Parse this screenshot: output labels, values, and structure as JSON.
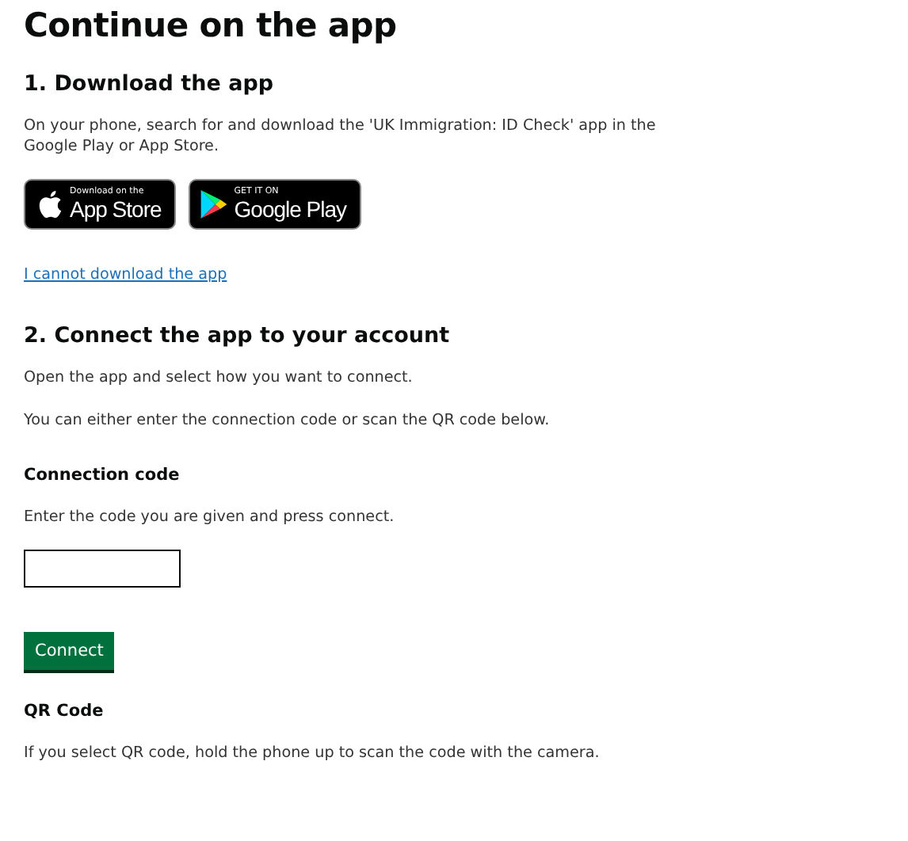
{
  "title": "Continue on the app",
  "step_1": {
    "heading": "1. Download the app",
    "text": "On your phone, search for and download the 'UK Immigration: ID Check' app in the Google Play or App Store.",
    "badges": [
      {
        "kind": "apple",
        "small": "Download on the",
        "large": "App Store"
      },
      {
        "kind": "google",
        "small": "GET IT ON",
        "large": "Google Play"
      }
    ],
    "link": "I cannot download the app"
  },
  "step_2": {
    "heading": "2. Connect the app to your account",
    "paragraphs": [
      "Open the app and select how you want to connect.",
      "You can either enter the connection code or scan the QR code below."
    ],
    "connection_code": {
      "label": "Connection code",
      "hint": "Enter the code you are given and press connect.",
      "button": "Connect"
    },
    "qr_code": {
      "label": "QR Code",
      "hint": "If you select QR code, hold the phone up to scan the code with the camera."
    }
  }
}
